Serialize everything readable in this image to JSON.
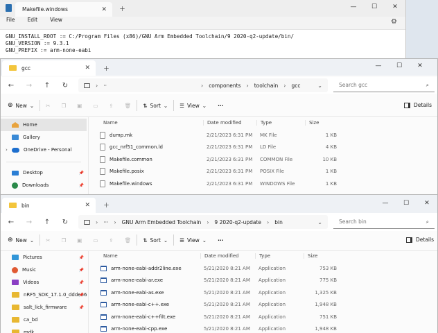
{
  "notepad": {
    "tab_title": "Makefile.windows",
    "menu": [
      "File",
      "Edit",
      "View"
    ],
    "lines": [
      "GNU_INSTALL_ROOT := C:/Program Files (x86)/GNU Arm Embedded Toolchain/9 2020-q2-update/bin/",
      "GNU_VERSION := 9.3.1",
      "GNU_PREFIX := arm-none-eabi"
    ]
  },
  "gcc_window": {
    "tab_title": "gcc",
    "breadcrumb": [
      "··",
      "components",
      "toolchain",
      "gcc"
    ],
    "search_placeholder": "Search gcc",
    "toolbar": {
      "new": "New",
      "sort": "Sort",
      "view": "View",
      "more": "···",
      "details": "Details"
    },
    "sidebar": [
      {
        "label": "Home",
        "icon": "home-icon",
        "selected": true
      },
      {
        "label": "Gallery",
        "icon": "gallery-icon"
      },
      {
        "label": "OneDrive - Personal",
        "icon": "cloud-icon",
        "expandable": true
      },
      {
        "label": "Desktop",
        "icon": "desktop-icon",
        "pinned": true
      },
      {
        "label": "Downloads",
        "icon": "downloads-icon",
        "pinned": true
      }
    ],
    "columns": [
      "Name",
      "Date modified",
      "Type",
      "Size"
    ],
    "files": [
      {
        "name": "dump.mk",
        "date": "2/21/2023 6:31 PM",
        "type": "MK File",
        "size": "1 KB"
      },
      {
        "name": "gcc_nrf51_common.ld",
        "date": "2/21/2023 6:31 PM",
        "type": "LD File",
        "size": "4 KB"
      },
      {
        "name": "Makefile.common",
        "date": "2/21/2023 6:31 PM",
        "type": "COMMON File",
        "size": "10 KB"
      },
      {
        "name": "Makefile.posix",
        "date": "2/21/2023 6:31 PM",
        "type": "POSIX File",
        "size": "1 KB"
      },
      {
        "name": "Makefile.windows",
        "date": "2/21/2023 6:31 PM",
        "type": "WINDOWS File",
        "size": "1 KB"
      }
    ]
  },
  "bin_window": {
    "tab_title": "bin",
    "breadcrumb": [
      "···",
      "GNU Arm Embedded Toolchain",
      "9 2020-q2-update",
      "bin"
    ],
    "search_placeholder": "Search bin",
    "toolbar": {
      "new": "New",
      "sort": "Sort",
      "view": "View",
      "more": "···",
      "details": "Details"
    },
    "sidebar": [
      {
        "label": "Pictures",
        "icon": "pictures-icon",
        "pinned": true
      },
      {
        "label": "Music",
        "icon": "music-icon",
        "pinned": true
      },
      {
        "label": "Videos",
        "icon": "videos-icon",
        "pinned": true
      },
      {
        "label": "nRF5_SDK_17.1.0_ddde560",
        "icon": "folder-icon",
        "pinned": true
      },
      {
        "label": "salt_lick_firmware",
        "icon": "folder-icon",
        "pinned": true
      },
      {
        "label": "ca_bd",
        "icon": "folder-icon"
      },
      {
        "label": "mdk",
        "icon": "folder-icon"
      }
    ],
    "columns": [
      "Name",
      "Date modified",
      "Type",
      "Size"
    ],
    "files": [
      {
        "name": "arm-none-eabi-addr2line.exe",
        "date": "5/21/2020 8:21 AM",
        "type": "Application",
        "size": "753 KB"
      },
      {
        "name": "arm-none-eabi-ar.exe",
        "date": "5/21/2020 8:21 AM",
        "type": "Application",
        "size": "775 KB"
      },
      {
        "name": "arm-none-eabi-as.exe",
        "date": "5/21/2020 8:21 AM",
        "type": "Application",
        "size": "1,325 KB"
      },
      {
        "name": "arm-none-eabi-c++.exe",
        "date": "5/21/2020 8:21 AM",
        "type": "Application",
        "size": "1,948 KB"
      },
      {
        "name": "arm-none-eabi-c++filt.exe",
        "date": "5/21/2020 8:21 AM",
        "type": "Application",
        "size": "751 KB"
      },
      {
        "name": "arm-none-eabi-cpp.exe",
        "date": "5/21/2020 8:21 AM",
        "type": "Application",
        "size": "1,948 KB"
      }
    ]
  }
}
